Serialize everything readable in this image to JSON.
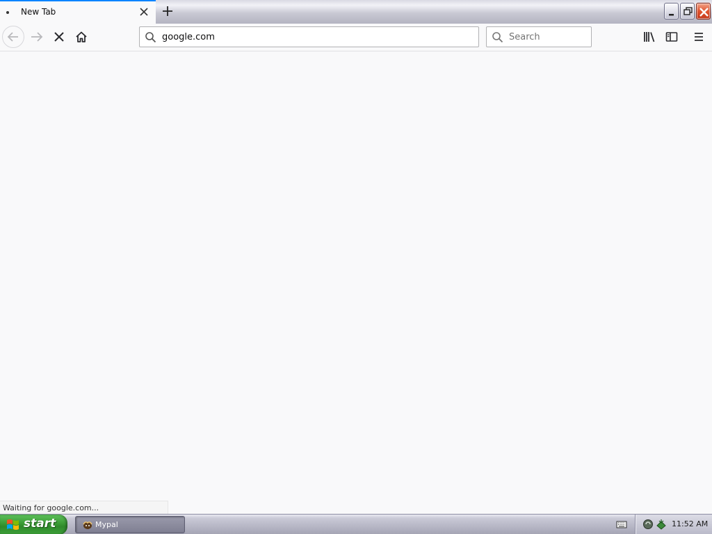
{
  "tabs": [
    {
      "title": "New Tab",
      "active": true
    }
  ],
  "window_controls": {
    "minimize_icon": "minimize-icon",
    "restore_icon": "restore-icon",
    "close_icon": "close-icon"
  },
  "toolbar": {
    "back_icon": "arrow-left-icon",
    "forward_icon": "arrow-right-icon",
    "stop_icon": "stop-x-icon",
    "home_icon": "home-icon",
    "library_icon": "library-icon",
    "sidebar_icon": "sidebar-icon",
    "menu_icon": "hamburger-menu-icon"
  },
  "urlbar": {
    "value": "google.com",
    "icon": "search-icon"
  },
  "searchbar": {
    "placeholder": "Search",
    "icon": "search-icon"
  },
  "status": {
    "text": "Waiting for google.com..."
  },
  "taskbar": {
    "start_label": "start",
    "tasks": [
      {
        "label": "Mypal",
        "icon": "mypal-app-icon"
      }
    ],
    "clock": "11:52 AM"
  },
  "colors": {
    "accent": "#0a84ff",
    "page_background": "#f9f9fa",
    "start_green": "#3a9a34",
    "close_red": "#e0542f"
  }
}
